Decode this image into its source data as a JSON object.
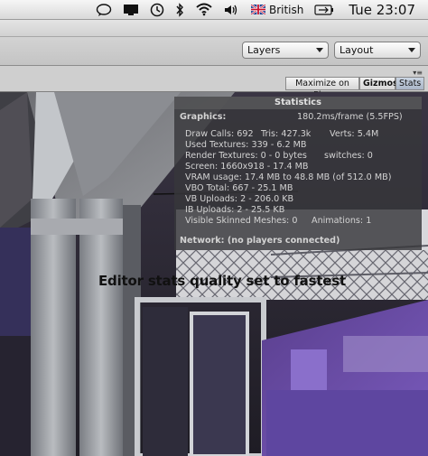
{
  "menubar": {
    "icons": [
      "chat-bubble-icon",
      "display-icon",
      "time-machine-icon",
      "bluetooth-icon",
      "wifi-icon",
      "volume-icon",
      "battery-icon"
    ],
    "input_language": "British",
    "clock": "Tue 23:07"
  },
  "toolbar": {
    "layers_label": "Layers",
    "layout_label": "Layout"
  },
  "scene_bar": {
    "maximize_on_play": "Maximize on Play",
    "gizmos": "Gizmos",
    "stats": "Stats"
  },
  "stats": {
    "title": "Statistics",
    "graphics_label": "Graphics:",
    "graphics_value": "180.2ms/frame (5.5FPS)",
    "draw_calls": "Draw Calls: 692",
    "tris": "Tris: 427.3k",
    "verts": "Verts: 5.4M",
    "used_textures": "Used Textures: 339 - 6.2 MB",
    "render_textures": "Render Textures: 0 - 0 bytes",
    "switches": "switches: 0",
    "screen": "Screen: 1660x918 - 17.4 MB",
    "vram": "VRAM usage: 17.4 MB to 48.8 MB (of 512.0 MB)",
    "vbo_total": "VBO Total: 667 - 25.1 MB",
    "vb_uploads": "VB Uploads: 2 - 206.0 KB",
    "ib_uploads": "IB Uploads: 2 - 25.5 KB",
    "visible_skinned": "Visible Skinned Meshes: 0",
    "animations": "Animations: 1",
    "network": "Network: (no players connected)"
  },
  "caption": "Editor stats quality set to fastest",
  "colors": {
    "accent_stats_button": "#aab6c7",
    "scene_purple": "#6a4fa6"
  }
}
